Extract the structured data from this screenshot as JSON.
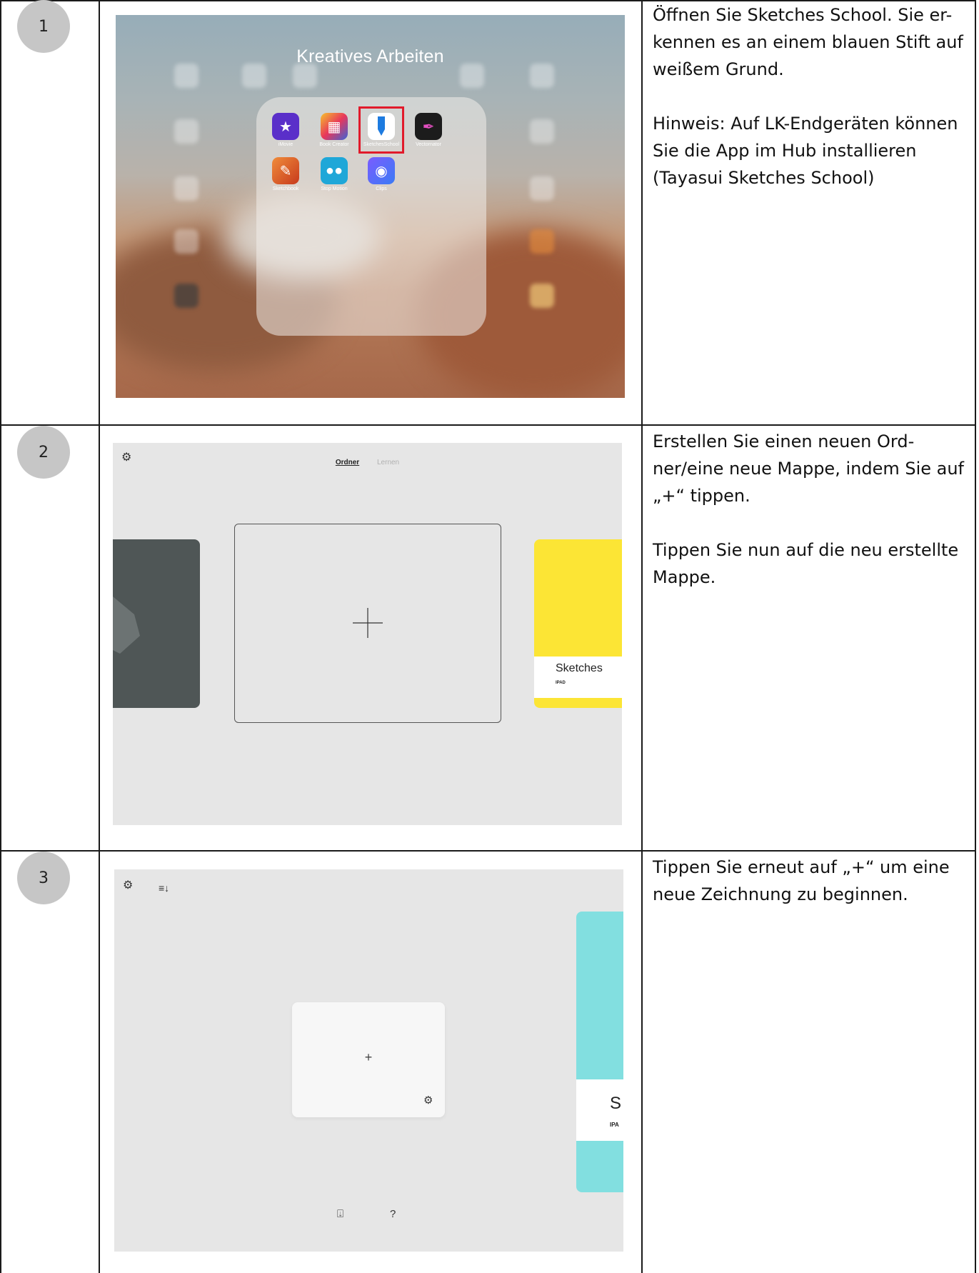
{
  "rows": [
    {
      "step": "1",
      "paragraphs": [
        "Öffnen Sie Sketches School. Sie er-kennen es an einem blauen Stift auf weißem Grund.",
        "Hinweis: Auf LK-Endgeräten können Sie die App im Hub installieren (Tayasui Sketches School)"
      ],
      "screenshot": {
        "folder_title": "Kreatives Arbeiten",
        "apps": [
          {
            "label": "iMovie",
            "icon": "imovie-icon",
            "color": "#5a2fc9"
          },
          {
            "label": "Book Creator",
            "icon": "book-creator-icon",
            "color": "#3b63d6"
          },
          {
            "label": "SketchesSchool",
            "icon": "sketches-school-icon",
            "color": "#ffffff"
          },
          {
            "label": "Vectornator",
            "icon": "vectornator-icon",
            "color": "#1c1c1c"
          },
          {
            "label": "Sketchbook",
            "icon": "sketchbook-icon",
            "color": "#e8542a"
          },
          {
            "label": "Stop Motion",
            "icon": "stop-motion-icon",
            "color": "#1fa7d8"
          },
          {
            "label": "Clips",
            "icon": "clips-icon",
            "color": "#3a7bf5"
          }
        ],
        "highlight_color": "#e11a2b"
      }
    },
    {
      "step": "2",
      "paragraphs": [
        "Erstellen Sie einen neuen Ord-ner/eine neue Mappe, indem Sie auf „+“ tippen.",
        "Tippen Sie nun auf die neu erstellte Mappe."
      ],
      "screenshot": {
        "tab_active": "Ordner",
        "tab_inactive": "Lernen",
        "plus": "+",
        "card_title": "Sketches",
        "card_subtitle": "IPAD",
        "card_color": "#fce535"
      }
    },
    {
      "step": "3",
      "paragraphs": [
        "Tippen Sie erneut auf „+“ um eine neue Zeichnung zu beginnen."
      ],
      "screenshot": {
        "plus": "+",
        "card_title": "S",
        "card_subtitle": "IPA",
        "card_color": "#82dfe0",
        "help": "?"
      }
    }
  ]
}
